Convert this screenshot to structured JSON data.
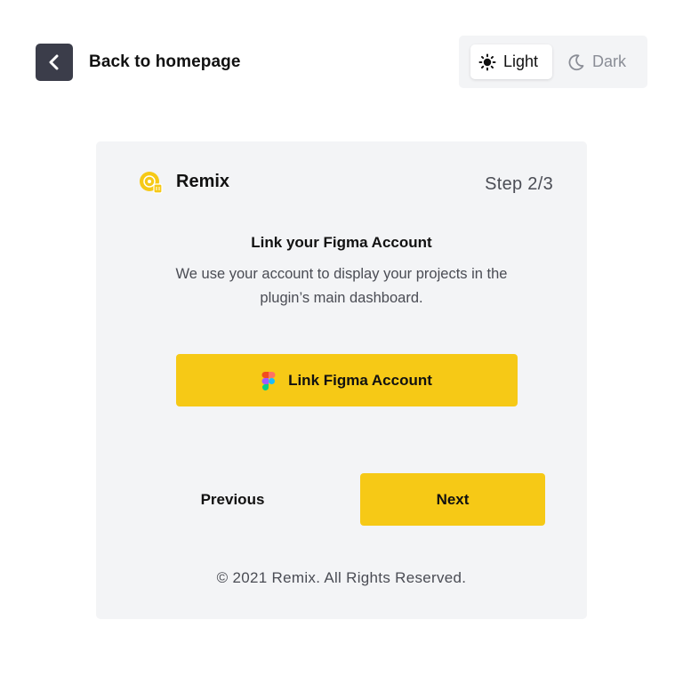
{
  "header": {
    "back_icon": "chevron-left-icon",
    "back_label": "Back to homepage"
  },
  "theme": {
    "light_label": "Light",
    "dark_label": "Dark",
    "selected": "Light",
    "light_icon": "sun-icon",
    "dark_icon": "moon-icon"
  },
  "card": {
    "brand": "Remix",
    "logo_icon": "remix-logo-icon",
    "step": "Step 2/3",
    "heading": "Link your Figma Account",
    "description": "We use your account to display your projects in the plugin’s main dashboard.",
    "link_button_label": "Link Figma Account",
    "link_button_icon": "figma-icon",
    "previous_label": "Previous",
    "next_label": "Next",
    "footer": "© 2021 Remix. All Rights Reserved."
  },
  "colors": {
    "accent": "#f6c916",
    "dark_button": "#3b3d4a",
    "card_bg": "#f3f4f6"
  }
}
